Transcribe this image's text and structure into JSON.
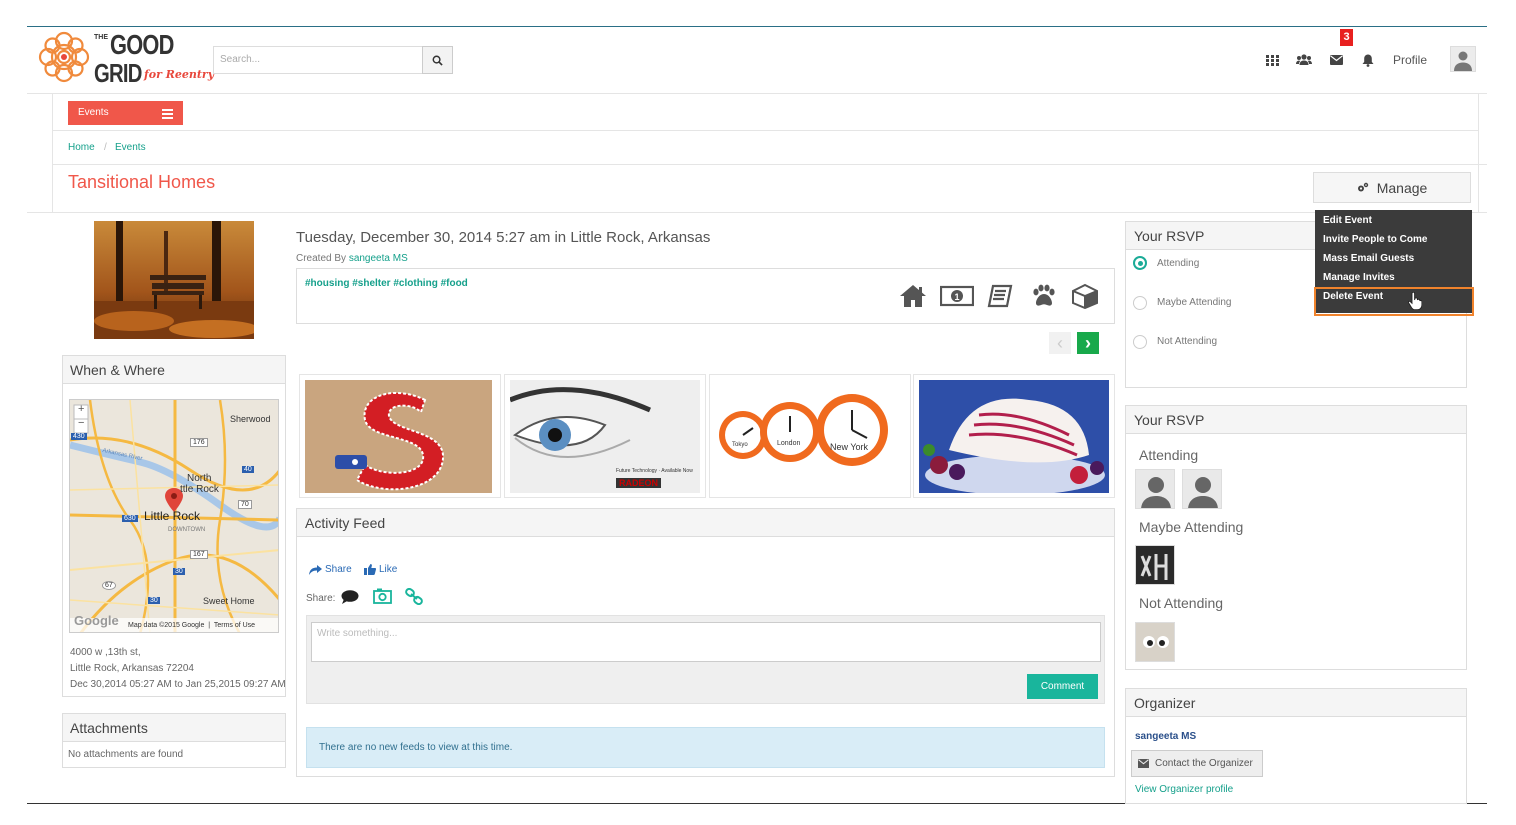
{
  "app": {
    "logo_top": "THE",
    "logo_main1": "GOOD",
    "logo_main2": "GRID",
    "logo_script": "for Reentry"
  },
  "header": {
    "search_placeholder": "Search...",
    "message_badge": "3",
    "profile_label": "Profile",
    "icons": [
      "grid-icon",
      "people-icon",
      "envelope-icon",
      "bell-icon"
    ]
  },
  "subnav": {
    "events_label": "Events"
  },
  "breadcrumb": {
    "home": "Home",
    "separator": "/",
    "current": "Events"
  },
  "page": {
    "title": "Tansitional Homes",
    "manage_label": "Manage"
  },
  "manage_menu": {
    "items": [
      "Edit Event",
      "Invite People to Come",
      "Mass Email Guests",
      "Manage Invites",
      "Delete Event"
    ]
  },
  "event": {
    "datetime_location": "Tuesday, December 30, 2014 5:27 am in Little Rock, Arkansas",
    "created_by_label": "Created By",
    "created_by_name": "sangeeta MS",
    "tags": "#housing #shelter #clothing #food",
    "category_icons": [
      "home-icon",
      "money-icon",
      "book-icon",
      "paw-icon",
      "box-icon"
    ]
  },
  "when_where": {
    "title": "When & Where",
    "address_line1": "4000 w ,13th st,",
    "address_line2": "Little Rock, Arkansas 72204",
    "date_range": "Dec 30,2014 05:27 AM to Jan 25,2015 09:27 AM",
    "map": {
      "labels": {
        "sherwood": "Sherwood",
        "north_little_rock_1": "North",
        "north_little_rock_2": "ttle Rock",
        "little_rock": "Little Rock",
        "downtown": "DOWNTOWN",
        "sweet_home": "Sweet Home",
        "arkansas_river": "Arkansas River",
        "r176": "176",
        "r40": "40",
        "r70": "70",
        "r430": "430",
        "r630": "630",
        "r167": "167",
        "r30a": "30",
        "r30b": "30",
        "r67": "67",
        "zoom_in": "+",
        "zoom_out": "−"
      },
      "footer": "Map data ©2015 Google  |  Terms of Use",
      "google": "Google"
    }
  },
  "attachments": {
    "title": "Attachments",
    "empty": "No attachments are found"
  },
  "gallery": {
    "prev": "‹",
    "next": "›",
    "images": [
      "felt-letter-s-image",
      "eye-closeup-image",
      "alarm-clocks-image",
      "ice-cream-berries-image"
    ],
    "clock_labels": [
      "Tokyo",
      "London",
      "New York"
    ],
    "eye_caption_1": "Future Technology · Available Now",
    "eye_caption_2": "RADEON"
  },
  "activity": {
    "title": "Activity Feed",
    "share_label": "Share",
    "like_label": "Like",
    "share_prefix": "Share:",
    "input_placeholder": "Write something...",
    "comment_label": "Comment",
    "empty": "There are no new feeds to view at this time."
  },
  "rsvp_form": {
    "title": "Your RSVP",
    "options": [
      "Attending",
      "Maybe Attending",
      "Not Attending"
    ],
    "selected_index": 0
  },
  "rsvp_list": {
    "title": "Your RSVP",
    "attending_label": "Attending",
    "maybe_label": "Maybe Attending",
    "not_label": "Not Attending"
  },
  "organizer": {
    "title": "Organizer",
    "name": "sangeeta MS",
    "contact_label": "Contact the Organizer",
    "profile_link": "View Organizer profile"
  },
  "colors": {
    "accent_red": "#f0574a",
    "teal": "#15a08b",
    "button_teal": "#19b59c",
    "highlight_orange": "#f0832c",
    "menu_dark": "#3b3b3b"
  }
}
